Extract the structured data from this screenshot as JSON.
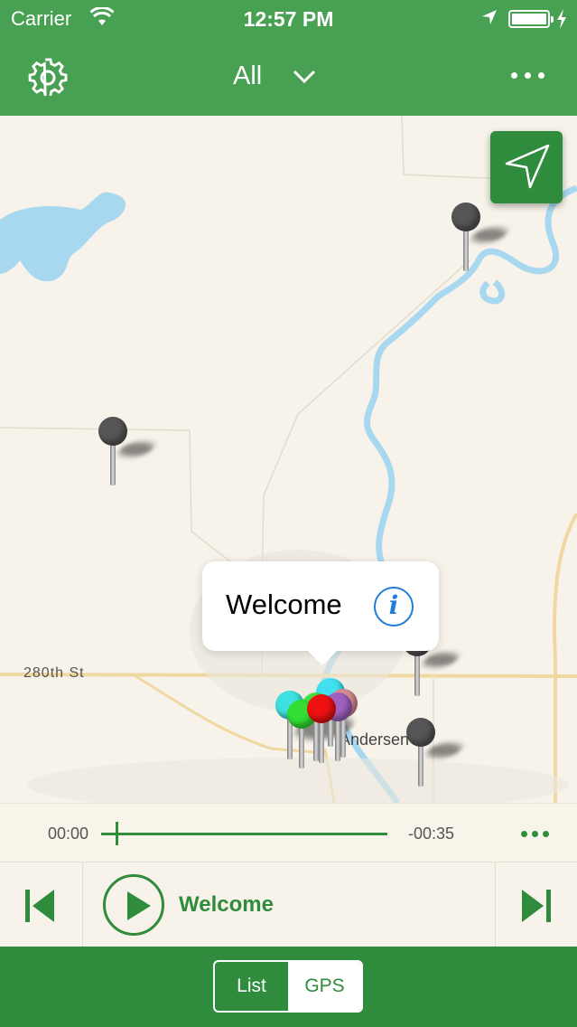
{
  "status_bar": {
    "carrier": "Carrier",
    "time": "12:57 PM",
    "battery_level": 1.0
  },
  "nav": {
    "filter_label": "All",
    "settings_icon": "gear-icon",
    "more_icon": "more-icon"
  },
  "map": {
    "road_label": "280th St",
    "town_label": "Andersen",
    "callout": {
      "title": "Welcome",
      "info_glyph": "i"
    },
    "colors": {
      "land": "#f7f3ea",
      "water": "#a8d8f0",
      "road": "#f0d9a0"
    }
  },
  "player": {
    "time_elapsed": "00:00",
    "time_remaining": "-00:35",
    "progress": 0.05,
    "track_title": "Welcome"
  },
  "tabs": {
    "list_label": "List",
    "gps_label": "GPS",
    "selected": "GPS"
  },
  "colors": {
    "header": "#48a052",
    "accent": "#2f8c3c"
  }
}
